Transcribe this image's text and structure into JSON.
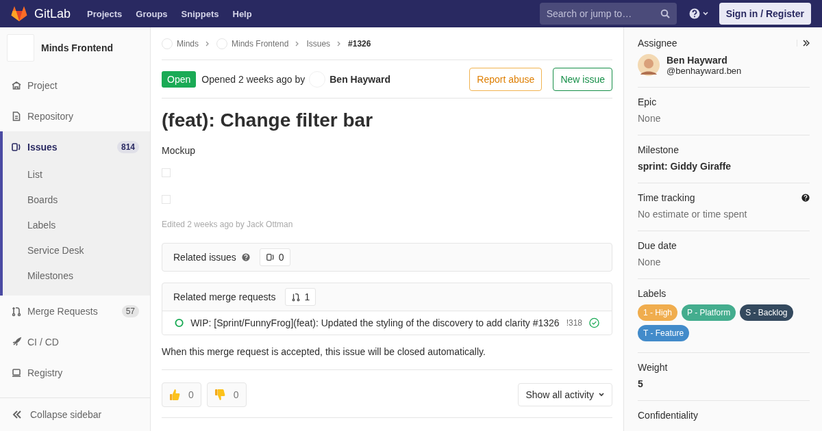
{
  "navbar": {
    "brand": "GitLab",
    "links": [
      "Projects",
      "Groups",
      "Snippets",
      "Help"
    ],
    "search": {
      "placeholder": "Search or jump to…"
    },
    "sign_in": "Sign in / Register"
  },
  "sidebar": {
    "project_name": "Minds Frontend",
    "items": [
      {
        "kind": "project",
        "label": "Project",
        "selected": false
      },
      {
        "kind": "repository",
        "label": "Repository",
        "selected": false
      },
      {
        "kind": "issues",
        "label": "Issues",
        "count": "814",
        "selected": true,
        "children": [
          {
            "label": "List"
          },
          {
            "label": "Boards"
          },
          {
            "label": "Labels"
          },
          {
            "label": "Service Desk"
          },
          {
            "label": "Milestones"
          }
        ]
      },
      {
        "kind": "merge",
        "label": "Merge Requests",
        "count": "57",
        "selected": false
      },
      {
        "kind": "rocket",
        "label": "CI / CD",
        "selected": false
      },
      {
        "kind": "registry",
        "label": "Registry",
        "selected": false
      }
    ],
    "collapse": "Collapse sidebar"
  },
  "breadcrumbs": [
    {
      "label": "Minds",
      "avatar": true
    },
    {
      "label": "Minds Frontend",
      "avatar": true
    },
    {
      "label": "Issues",
      "avatar": false
    },
    {
      "label": "#1326",
      "avatar": false
    }
  ],
  "issue": {
    "status": "Open",
    "opened": "Opened 2 weeks ago by",
    "author": "Ben Hayward",
    "buttons": [
      {
        "kind": "warning",
        "label": "Report abuse"
      },
      {
        "kind": "success",
        "label": "New issue"
      }
    ],
    "title": "(feat): Change filter bar",
    "description": "Mockup",
    "tasks": [
      {
        "checked": false
      },
      {
        "checked": false
      }
    ],
    "edited": "Edited 2 weeks ago by Jack Ottman"
  },
  "related_issues": {
    "title": "Related issues",
    "count": "0"
  },
  "related_merge_requests": {
    "title": "Related merge requests",
    "count": "1",
    "items": [
      {
        "title": "WIP: [Sprint/FunnyFrog](feat): Updated the styling of the discovery to add clarity #1326",
        "ref": "!318"
      }
    ]
  },
  "closing_note": "When this merge request is accepted, this issue will be closed automatically.",
  "reactions": [
    {
      "kind": "thumbsup",
      "count": "0"
    },
    {
      "kind": "thumbsdown",
      "count": "0"
    }
  ],
  "activity_filter": "Show all activity",
  "right_sidebar": {
    "assignee": {
      "heading": "Assignee",
      "name": "Ben Hayward",
      "username": "@benhayward.ben"
    },
    "sections": [
      {
        "kind": "plain",
        "heading": "Epic",
        "value": "None"
      },
      {
        "kind": "bold",
        "heading": "Milestone",
        "value": "sprint: Giddy Giraffe"
      },
      {
        "kind": "help",
        "heading": "Time tracking",
        "value": "No estimate or time spent"
      },
      {
        "kind": "plain",
        "heading": "Due date",
        "value": "None"
      },
      {
        "kind": "labels",
        "heading": "Labels",
        "labels": [
          {
            "label": "1 - High",
            "color": "#f0ad4e"
          },
          {
            "label": "P - Platform",
            "color": "#44ad8e"
          },
          {
            "label": "S - Backlog",
            "color": "#34495e"
          },
          {
            "label": "T - Feature",
            "color": "#428bca"
          }
        ]
      },
      {
        "kind": "bold",
        "heading": "Weight",
        "value": "5"
      },
      {
        "kind": "heading",
        "heading": "Confidentiality"
      }
    ]
  }
}
